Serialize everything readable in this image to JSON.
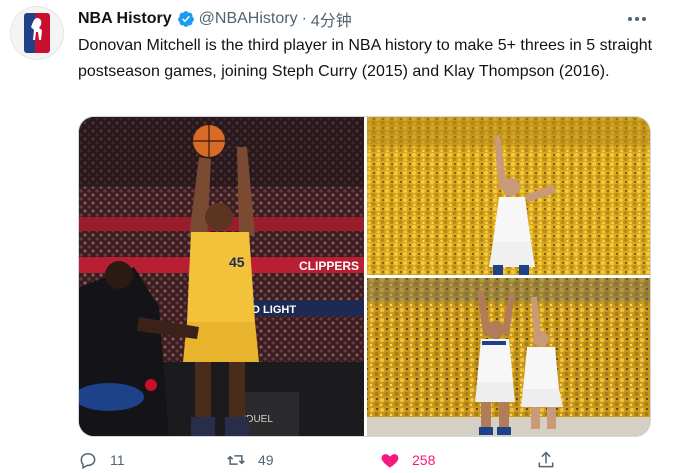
{
  "tweet": {
    "display_name": "NBA History",
    "handle": "@NBAHistory",
    "separator": "·",
    "time": "4分钟",
    "text": "Donovan Mitchell is the third player in NBA history to make 5+ threes in 5 straight postseason games, joining Steph Curry (2015) and Klay Thompson (2016).",
    "verified": true,
    "media": [
      {
        "jersey_number": "45",
        "arena_text": "CLIPPERS",
        "ad_text": "ID LIGHT",
        "sponsor_text": "NDUEL"
      }
    ]
  },
  "actions": {
    "reply_count": "11",
    "retweet_count": "49",
    "like_count": "258",
    "liked": true
  },
  "colors": {
    "text": "#0f1419",
    "secondary": "#536471",
    "verified": "#1d9bf0",
    "like": "#f91880",
    "jazz_gold": "#f2c33a",
    "warriors_blue": "#1d428a"
  }
}
